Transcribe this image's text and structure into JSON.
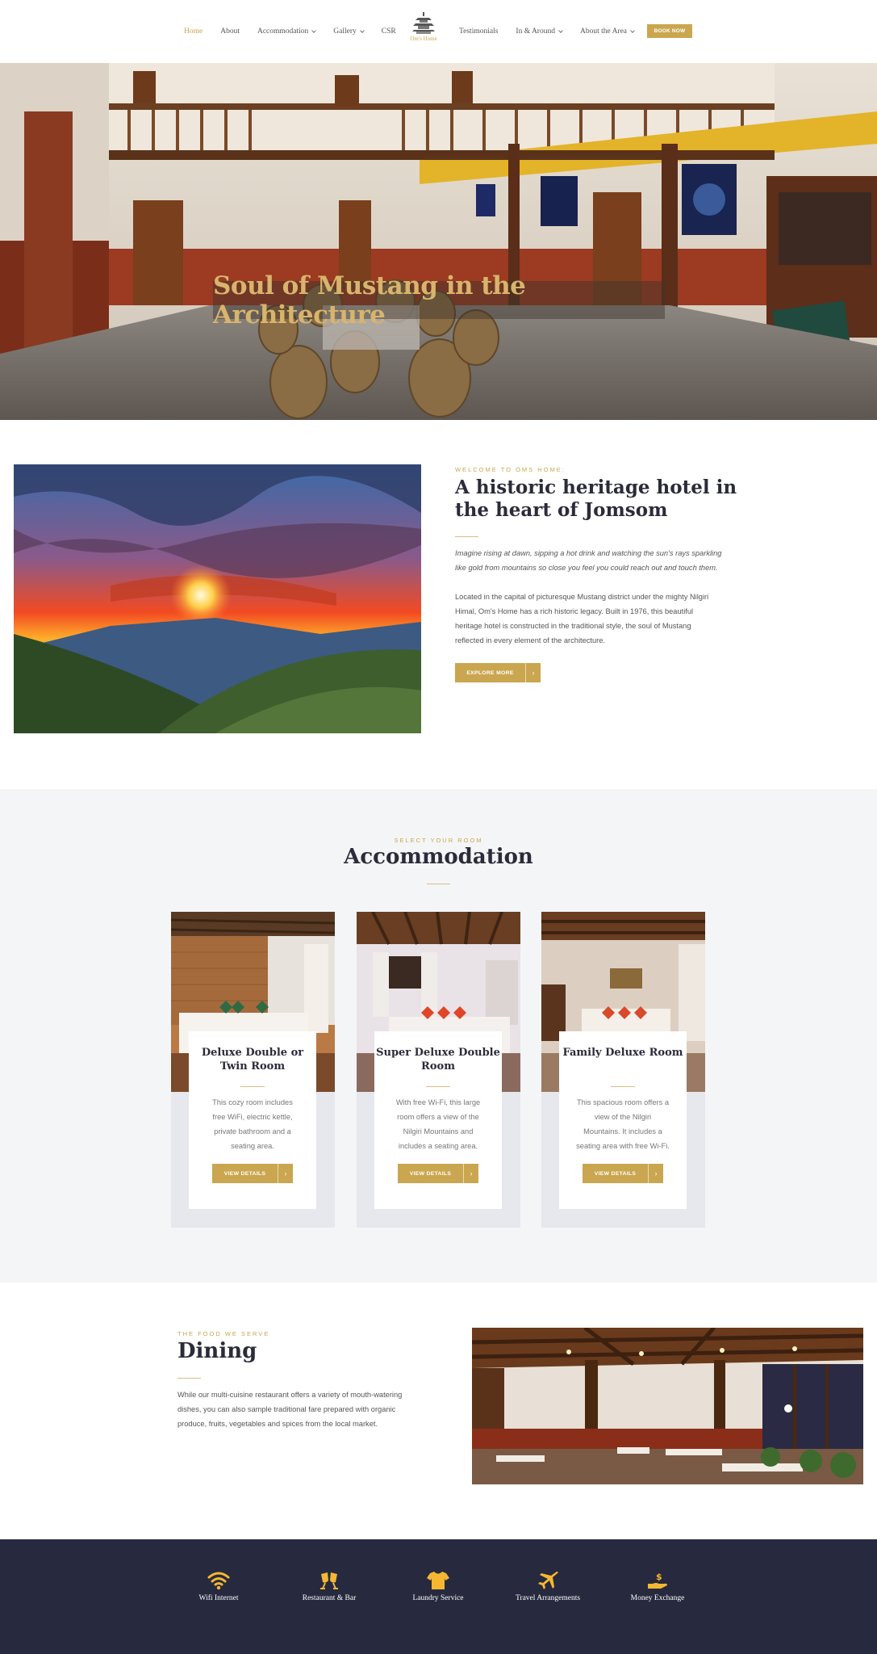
{
  "nav": {
    "left": [
      {
        "label": "Home",
        "active": true,
        "dropdown": false
      },
      {
        "label": "About",
        "active": false,
        "dropdown": false
      },
      {
        "label": "Accommodation",
        "active": false,
        "dropdown": true
      },
      {
        "label": "Gallery",
        "active": false,
        "dropdown": true
      },
      {
        "label": "CSR",
        "active": false,
        "dropdown": false
      }
    ],
    "right": [
      {
        "label": "Testimonials",
        "active": false,
        "dropdown": false
      },
      {
        "label": "In & Around",
        "active": false,
        "dropdown": true
      },
      {
        "label": "About the Area",
        "active": false,
        "dropdown": true
      }
    ],
    "logo_text": "Om's Home",
    "book_label": "BOOK NOW"
  },
  "hero": {
    "title": "Soul of Mustang in the Architecture"
  },
  "about": {
    "eyebrow": "WELCOME TO OMS HOME:",
    "title": "A historic heritage hotel in the heart of Jomsom",
    "lead": "Imagine rising at dawn, sipping a hot drink and watching the sun's rays sparkling like gold from mountains so close you feel you could reach out and touch them.",
    "body": "Located in the capital of picturesque Mustang district under the mighty Nilgiri Himal, Om's Home has a rich historic legacy. Built in 1976, this beautiful heritage hotel is constructed in the traditional style, the soul of Mustang reflected in every element of the architecture.",
    "button": "EXPLORE MORE"
  },
  "accommodation": {
    "eyebrow": "SELECT YOUR ROOM",
    "title": "Accommodation",
    "rooms": [
      {
        "title": "Deluxe Double or Twin Room",
        "desc": "This cozy room includes free WiFi, electric kettle, private bathroom and a seating area.",
        "button": "VIEW DETAILS"
      },
      {
        "title": "Super Deluxe Double Room",
        "desc": "With free Wi-Fi, this large room offers a view of the Nilgiri Mountains and includes a seating area.",
        "button": "VIEW DETAILS"
      },
      {
        "title": "Family Deluxe Room",
        "desc": "This spacious room offers a view of the Nilgiri Mountains. It includes a seating area with free Wi-Fi.",
        "button": "VIEW DETAILS"
      }
    ]
  },
  "dining": {
    "eyebrow": "THE FOOD WE SERVE",
    "title": "Dining",
    "body": "While our multi-cuisine restaurant offers a variety of mouth-watering dishes, you can also sample traditional fare prepared with organic produce, fruits, vegetables and spices from the local market."
  },
  "amenities": [
    {
      "label": "Wifi Internet",
      "icon": "wifi-icon"
    },
    {
      "label": "Restaurant & Bar",
      "icon": "cheers-icon"
    },
    {
      "label": "Laundry Service",
      "icon": "shirt-icon"
    },
    {
      "label": "Travel Arrangements",
      "icon": "plane-icon"
    },
    {
      "label": "Money Exchange",
      "icon": "money-hand-icon"
    }
  ],
  "colors": {
    "accent": "#c9a64f",
    "footer_bg": "#272a3e",
    "section_bg": "#f4f5f7",
    "heading": "#2b2b3a"
  }
}
